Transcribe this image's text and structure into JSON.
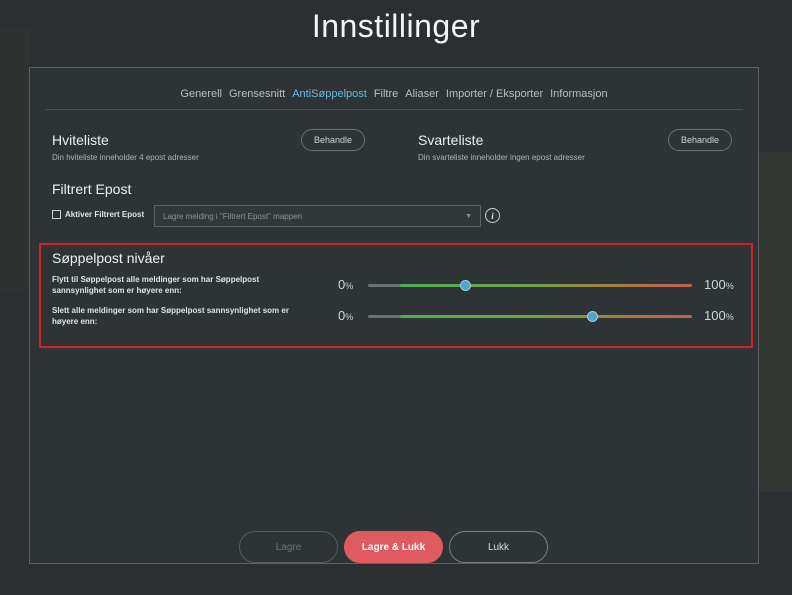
{
  "page_title": "Innstillinger",
  "tabs": [
    {
      "label": "Generell",
      "active": false
    },
    {
      "label": "Grensesnitt",
      "active": false
    },
    {
      "label": "AntiSøppelpost",
      "active": true
    },
    {
      "label": "Filtre",
      "active": false
    },
    {
      "label": "Aliaser",
      "active": false
    },
    {
      "label": "Importer / Eksporter",
      "active": false
    },
    {
      "label": "Informasjon",
      "active": false
    }
  ],
  "whitelist": {
    "title": "Hviteliste",
    "subtitle": "Din hviteliste inneholder 4 epost adresser",
    "button": "Behandle"
  },
  "blacklist": {
    "title": "Svarteliste",
    "subtitle": "Din svarteliste inneholder ingen epost adresser",
    "button": "Behandle"
  },
  "filtered": {
    "title": "Filtrert Epost",
    "checkbox_label": "Aktiver Filtrert Epost",
    "checkbox_checked": false,
    "select_value": "Lagre melding i \"Filtrert Epost\" mappen",
    "info_icon": "info-icon"
  },
  "spam_levels": {
    "title": "Søppelpost nivåer",
    "sliders": [
      {
        "label": "Flytt til Søppelpost alle meldinger som har Søppelpost sannsynlighet som er høyere enn:",
        "min_label": "0",
        "max_label": "100",
        "unit": "%",
        "value_fraction": 0.3
      },
      {
        "label": "Slett alle meldinger som har Søppelpost sannsynlighet som er høyere enn:",
        "min_label": "0",
        "max_label": "100",
        "unit": "%",
        "value_fraction": 0.69
      }
    ]
  },
  "footer": {
    "save": "Lagre",
    "save_close": "Lagre & Lukk",
    "close": "Lukk"
  },
  "colors": {
    "accent": "#6fb7dd",
    "primary_button": "#df5b5f",
    "highlight_border": "#d0202a"
  }
}
